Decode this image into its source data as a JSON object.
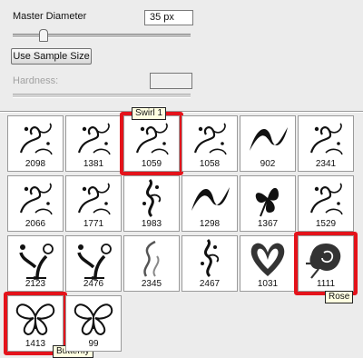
{
  "brush_panel": {
    "master_diameter_label": "Master Diameter",
    "master_diameter_value": "35 px",
    "master_diameter_slider_fraction": 0.17,
    "use_sample_size_label": "Use Sample Size",
    "hardness_label": "Hardness:"
  },
  "brushes": [
    {
      "number": "2098",
      "icon": "swirl-flourish-icon"
    },
    {
      "number": "1381",
      "icon": "swirl-flourish-icon"
    },
    {
      "number": "1059",
      "icon": "swirl-flourish-icon",
      "tooltip": "Swirl 1",
      "highlighted": true
    },
    {
      "number": "1058",
      "icon": "swirl-flourish-icon"
    },
    {
      "number": "902",
      "icon": "wave-icon"
    },
    {
      "number": "2341",
      "icon": "swirl-flourish-icon"
    },
    {
      "number": "2066",
      "icon": "swirl-flourish-icon"
    },
    {
      "number": "1771",
      "icon": "swirl-flourish-icon"
    },
    {
      "number": "1983",
      "icon": "vine-icon"
    },
    {
      "number": "1298",
      "icon": "wave-icon"
    },
    {
      "number": "1367",
      "icon": "flower-icon"
    },
    {
      "number": "1529",
      "icon": "swirl-flourish-icon"
    },
    {
      "number": "2123",
      "icon": "tree-icon"
    },
    {
      "number": "2476",
      "icon": "tree-icon"
    },
    {
      "number": "2345",
      "icon": "smoke-icon"
    },
    {
      "number": "2467",
      "icon": "vine-icon"
    },
    {
      "number": "1031",
      "icon": "heart-icon"
    },
    {
      "number": "1111",
      "icon": "rose-icon",
      "tooltip": "Rose",
      "highlighted": true
    },
    {
      "number": "1413",
      "icon": "butterfly-icon",
      "tooltip": "Butterfly",
      "highlighted": true
    },
    {
      "number": "99",
      "icon": "butterfly-icon"
    }
  ],
  "colors": {
    "highlight": "#e4131b",
    "tooltip_background": "#ffffe1"
  }
}
